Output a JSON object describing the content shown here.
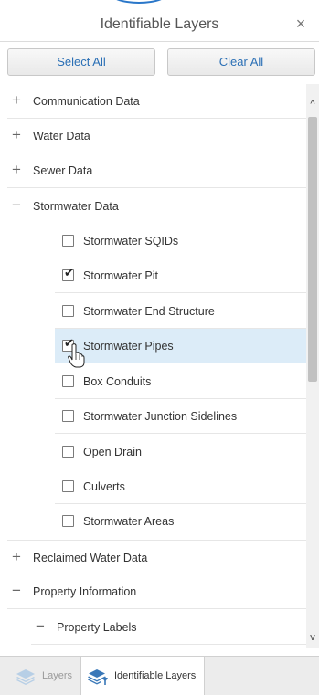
{
  "panel": {
    "title": "Identifiable Layers",
    "close_glyph": "×"
  },
  "buttons": {
    "select_all": "Select All",
    "clear_all": "Clear All"
  },
  "tree": {
    "communication": {
      "expander": "+",
      "label": "Communication Data"
    },
    "water": {
      "expander": "+",
      "label": "Water Data"
    },
    "sewer": {
      "expander": "+",
      "label": "Sewer Data"
    },
    "stormwater": {
      "expander": "−",
      "label": "Stormwater Data",
      "children": [
        {
          "label": "Stormwater SQIDs",
          "checked": false,
          "mark": ""
        },
        {
          "label": "Stormwater Pit",
          "checked": true,
          "mark": "✔"
        },
        {
          "label": "Stormwater End Structure",
          "checked": false,
          "mark": ""
        },
        {
          "label": "Stormwater Pipes",
          "checked": true,
          "mark": "✔"
        },
        {
          "label": "Box Conduits",
          "checked": false,
          "mark": ""
        },
        {
          "label": "Stormwater Junction Sidelines",
          "checked": false,
          "mark": ""
        },
        {
          "label": "Open Drain",
          "checked": false,
          "mark": ""
        },
        {
          "label": "Culverts",
          "checked": false,
          "mark": ""
        },
        {
          "label": "Stormwater Areas",
          "checked": false,
          "mark": ""
        }
      ]
    },
    "reclaimed": {
      "expander": "+",
      "label": "Reclaimed Water Data"
    },
    "property": {
      "expander": "−",
      "label": "Property Information"
    },
    "property_labels": {
      "expander": "−",
      "label": "Property Labels"
    }
  },
  "scrollbar": {
    "up_glyph": "^",
    "down_glyph": "v"
  },
  "tabs": {
    "layers": {
      "label": "Layers",
      "icon": "layers-icon"
    },
    "identifiable": {
      "label": "Identifiable Layers",
      "icon": "identify-layers-icon"
    }
  },
  "colors": {
    "accent": "#2a6fb5",
    "selected_row": "#dcecf8",
    "layers_icon": "#a9c6e3"
  }
}
